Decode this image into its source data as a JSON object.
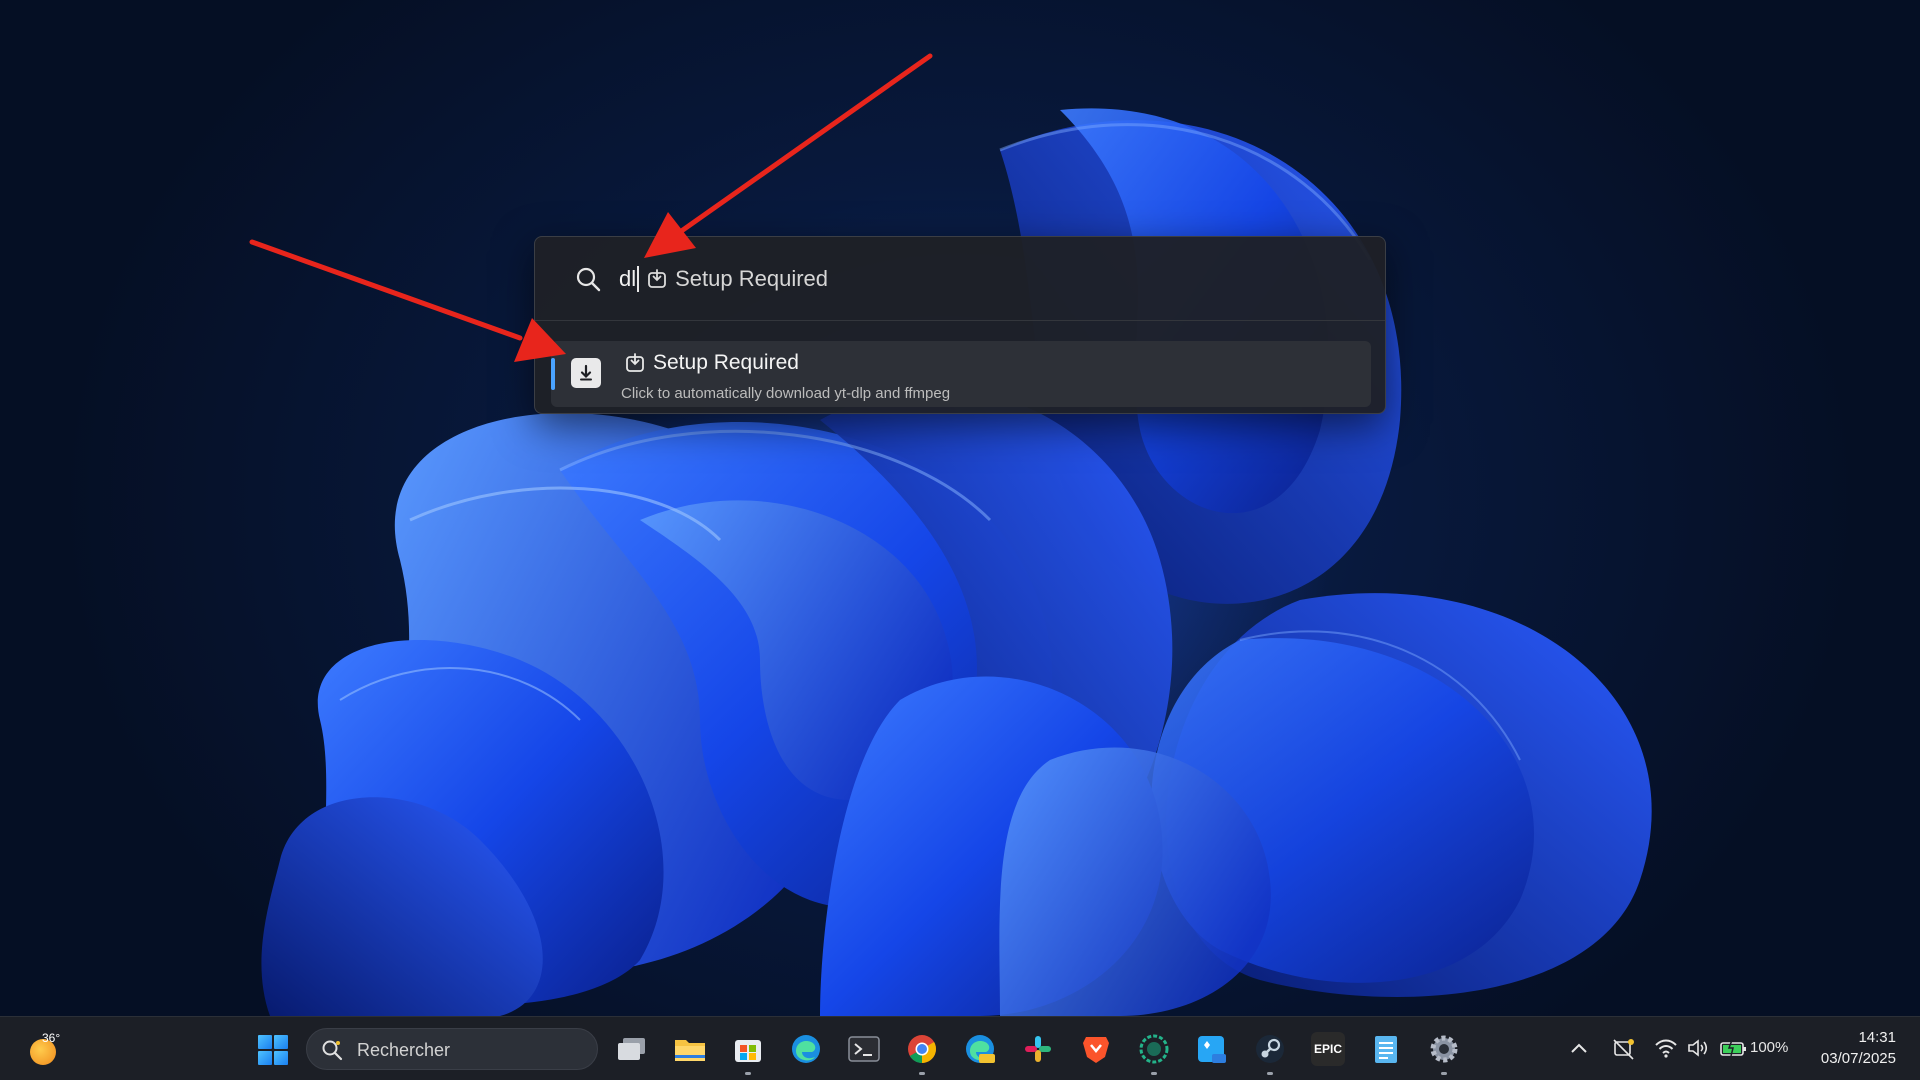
{
  "launcher": {
    "query": "dl",
    "inline_suggestion": "Setup Required",
    "result": {
      "title": "Setup Required",
      "subtitle": "Click to automatically download yt-dlp and ffmpeg"
    }
  },
  "taskbar": {
    "weather_temp": "36°",
    "search_placeholder": "Rechercher",
    "pinned_apps": [
      "task-view-icon",
      "file-explorer-icon",
      "microsoft-store-icon",
      "edge-icon",
      "terminal-icon",
      "chrome-icon",
      "edge-canary-icon",
      "slack-icon",
      "brave-icon",
      "app-circle-icon",
      "photo-editor-preview-icon",
      "steam-icon",
      "epic-games-icon",
      "notepad-icon",
      "settings-icon"
    ],
    "epic_label": "EPIC",
    "battery_percent": "100%",
    "time": "14:31",
    "date": "03/07/2025"
  },
  "colors": {
    "accent": "#4aa3ff",
    "arrow": "#e8251c",
    "launcher_bg": "#1e2026"
  }
}
